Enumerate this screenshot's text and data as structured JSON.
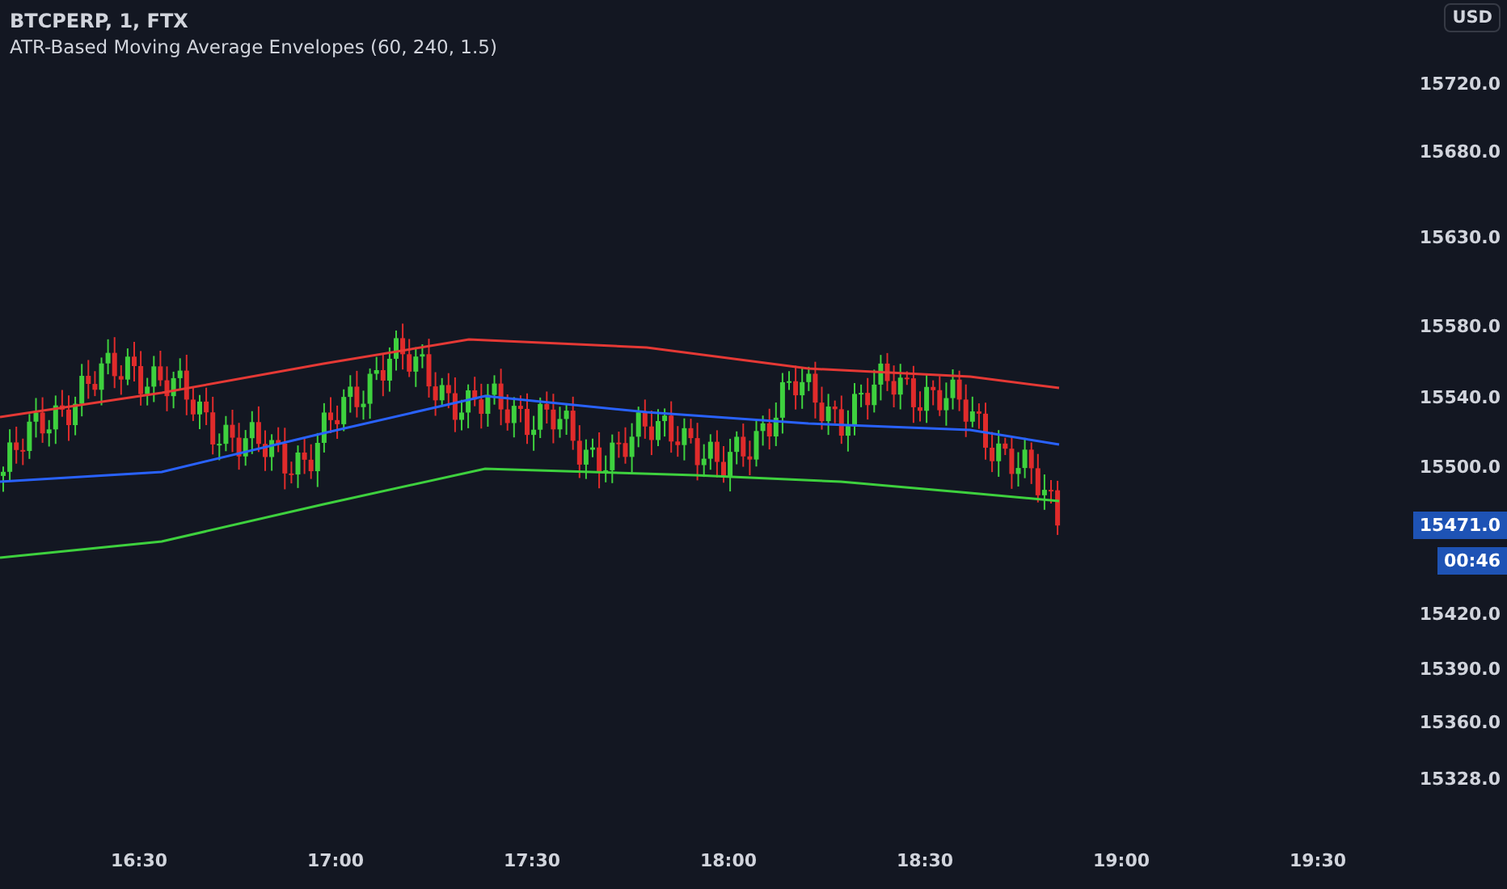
{
  "legend": {
    "symbol": "BTCPERP, 1, FTX",
    "indicator": "ATR-Based Moving Average Envelopes (60, 240, 1.5)"
  },
  "price_axis": {
    "currency": "USD",
    "labels": [
      "15720.0",
      "15680.0",
      "15630.0",
      "15580.0",
      "15540.0",
      "15500.0",
      "15420.0",
      "15390.0",
      "15360.0",
      "15328.0"
    ],
    "last_price": "15471.0",
    "countdown": "00:46"
  },
  "time_axis": {
    "labels": [
      "16:30",
      "17:00",
      "17:30",
      "18:00",
      "18:30",
      "19:00",
      "19:30"
    ]
  }
}
